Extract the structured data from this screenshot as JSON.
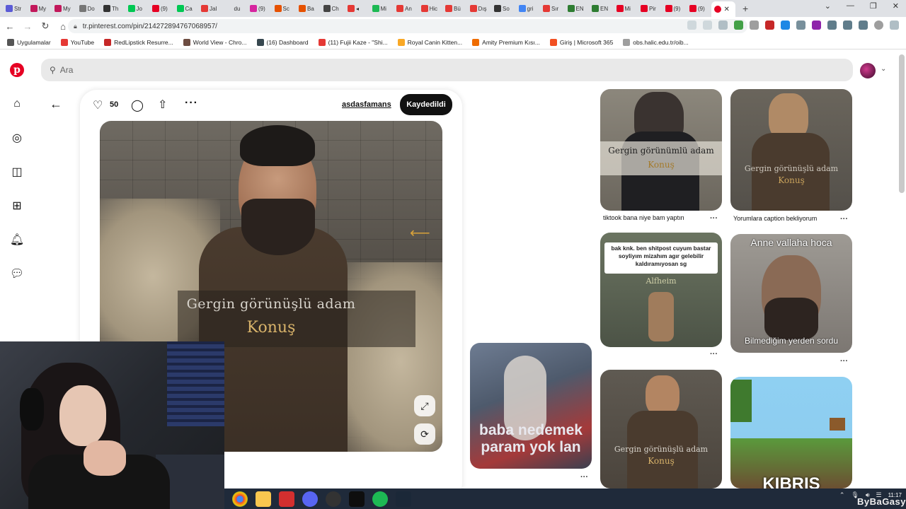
{
  "browser": {
    "tabs": [
      {
        "label": "Str",
        "color": "#5b5bd6"
      },
      {
        "label": "My",
        "color": "#c2185b"
      },
      {
        "label": "My",
        "color": "#c2185b"
      },
      {
        "label": "Do",
        "color": "#777777"
      },
      {
        "label": "Th",
        "color": "#333333"
      },
      {
        "label": "Jo",
        "color": "#00c853"
      },
      {
        "label": "(9)",
        "color": "#e60023"
      },
      {
        "label": "Ca",
        "color": "#00c853"
      },
      {
        "label": "Jal",
        "color": "#e53935"
      },
      {
        "label": "du",
        "color": "#dfe1e5"
      },
      {
        "label": "(9)",
        "color": "#d6249f"
      },
      {
        "label": "Sc",
        "color": "#e65100"
      },
      {
        "label": "Ba",
        "color": "#e65100"
      },
      {
        "label": "Ch",
        "color": "#444444"
      },
      {
        "label": "◂",
        "color": "#e53935"
      },
      {
        "label": "Mi",
        "color": "#1db954"
      },
      {
        "label": "An",
        "color": "#e53935"
      },
      {
        "label": "Hic",
        "color": "#e53935"
      },
      {
        "label": "Bü",
        "color": "#e53935"
      },
      {
        "label": "Dış",
        "color": "#e53935"
      },
      {
        "label": "So",
        "color": "#333333"
      },
      {
        "label": "gri",
        "color": "#4285f4"
      },
      {
        "label": "Sır",
        "color": "#e53935"
      },
      {
        "label": "EN",
        "color": "#2e7d32"
      },
      {
        "label": "EN",
        "color": "#2e7d32"
      },
      {
        "label": "Mi",
        "color": "#e60023"
      },
      {
        "label": "Pir",
        "color": "#e60023"
      },
      {
        "label": "(9)",
        "color": "#e60023"
      },
      {
        "label": "(9)",
        "color": "#e60023"
      }
    ],
    "active_tab_color": "#e60023",
    "window_controls": [
      "⌄",
      "—",
      "❐",
      "✕"
    ],
    "url": "tr.pinterest.com/pin/214272894767068957/",
    "bookmarks": [
      {
        "label": "Uygulamalar",
        "color": "#555555"
      },
      {
        "label": "YouTube",
        "color": "#e53935"
      },
      {
        "label": "RedLipstick Resurre...",
        "color": "#c62828"
      },
      {
        "label": "World View - Chro...",
        "color": "#6d4c41"
      },
      {
        "label": "(16) Dashboard",
        "color": "#37474f"
      },
      {
        "label": "(11) Fujii Kaze - \"Shi...",
        "color": "#e53935"
      },
      {
        "label": "Royal Canin Kitten...",
        "color": "#f9a825"
      },
      {
        "label": "Amity Premium Kısı...",
        "color": "#ef6c00"
      },
      {
        "label": "Giriş | Microsoft 365",
        "color": "#f25022"
      },
      {
        "label": "obs.halic.edu.tr/oib...",
        "color": "#9e9e9e"
      }
    ]
  },
  "pinterest": {
    "search_placeholder": "Ara",
    "brand_color": "#e60023",
    "logo_letter": "p",
    "likes": "50",
    "username": "asdasfamans",
    "saved_label": "Kaydedildi",
    "main_caption_1": "Gergin görünüşlü adam",
    "main_caption_2": "Konuş",
    "grid": [
      {
        "caption_1": "Gergin görünümlü adam",
        "caption_2": "Konuş",
        "title": "tiktook bana niye bam yaptın"
      },
      {
        "caption_1": "Gergin görünüşlü adam",
        "caption_2": "Konuş",
        "title": "Yorumlara caption bekliyorum"
      },
      {
        "text": "bak knk. ben shitpost cuyum bastar soyliyım mizahım agır gelebilir kaldıramıyosan sg",
        "sub": "Alfheim"
      },
      {
        "caption_top": "Anne vallaha hoca",
        "caption_bottom": "Bilmediğim yerden sordu"
      },
      {
        "caption": "baba nedemek param yok lan"
      },
      {
        "caption_1": "Gergin görünüşlü adam",
        "caption_2": "Konuş"
      },
      {
        "caption": "KIBRIS"
      }
    ]
  },
  "taskbar": {
    "clock_time": "11:17",
    "watermark": "ByBaGasy"
  }
}
